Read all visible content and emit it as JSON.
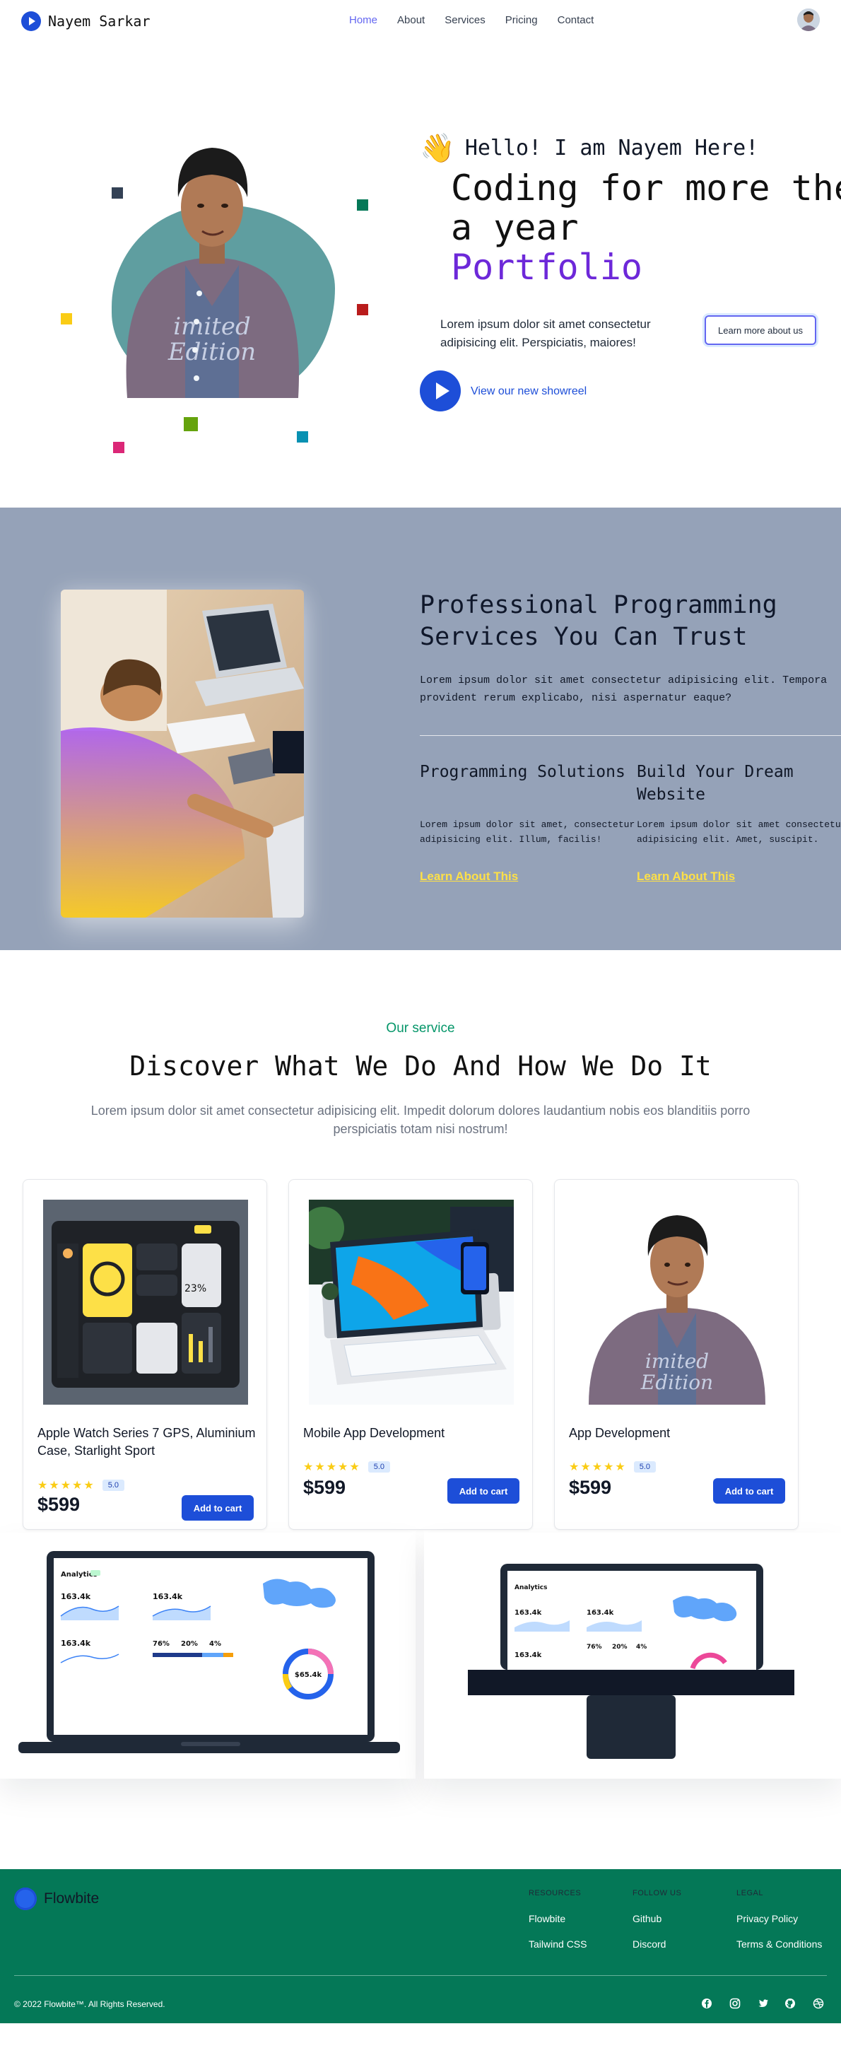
{
  "nav": {
    "brand": "Nayem Sarkar",
    "links": [
      {
        "label": "Home"
      },
      {
        "label": "About"
      },
      {
        "label": "Services"
      },
      {
        "label": "Pricing"
      },
      {
        "label": "Contact"
      }
    ],
    "active_color": "#6366f1"
  },
  "hero": {
    "wave_emoji": "👋",
    "hello": "Hello! I am Nayem Here!",
    "headline_line1": "Coding for more then",
    "headline_line2": "a year",
    "headline_accent": "Portfolio",
    "intro": "Lorem ipsum dolor sit amet consectetur adipisicing elit. Perspiciatis, maiores!",
    "more_button": "Learn more about us",
    "showreel_link": "View our new showreel",
    "accent_color": "#1d4ed8"
  },
  "professional": {
    "title": "Professional Programming Services You Can Trust",
    "lead_line1": "Lorem ipsum dolor sit amet consectetur adipisicing elit. Tempora",
    "lead_line2": "provident rerum explicabo, nisi aspernatur eaque?",
    "features": [
      {
        "title": "Programming Solutions",
        "text_line1": "Lorem ipsum dolor sit amet, consectetur",
        "text_line2": "adipisicing elit. Illum, facilis!",
        "link": "Learn About This"
      },
      {
        "title": "Build Your Dream Website",
        "text_line1": "Lorem ipsum dolor sit amet consectetur",
        "text_line2": "adipisicing elit. Amet, suscipit.",
        "link": "Learn About This"
      }
    ],
    "background": "#95a2b8",
    "link_color": "#fde047"
  },
  "services": {
    "eyebrow": "Our service",
    "title": "Discover What We Do And How We Do It",
    "description": "Lorem ipsum dolor sit amet consectetur adipisicing elit. Impedit dolorum dolores laudantium nobis eos blanditiis porro perspiciatis totam nisi nostrum!",
    "cards": [
      {
        "title": "Apple Watch Series 7 GPS, Aluminium Case, Starlight Sport",
        "rating": "5.0",
        "stars": 5,
        "price": "$599",
        "button": "Add to cart"
      },
      {
        "title": "Mobile App Development",
        "rating": "5.0",
        "stars": 5,
        "price": "$599",
        "button": "Add to cart"
      },
      {
        "title": "App Development",
        "rating": "5.0",
        "stars": 5,
        "price": "$599",
        "button": "Add to cart"
      }
    ]
  },
  "dashboard": {
    "section_label": "Analytics",
    "stats": [
      "163.4k",
      "163.4k",
      "163.4k",
      "163.4k"
    ],
    "percents": [
      "76%",
      "20%",
      "4%"
    ],
    "donut_value": "$65.4k"
  },
  "footer": {
    "brand": "Flowbite",
    "columns": [
      {
        "heading": "RESOURCES",
        "links": [
          "Flowbite",
          "Tailwind CSS"
        ]
      },
      {
        "heading": "FOLLOW US",
        "links": [
          "Github",
          "Discord"
        ]
      },
      {
        "heading": "LEGAL",
        "links": [
          "Privacy Policy",
          "Terms & Conditions"
        ]
      }
    ],
    "copyright": "© 2022 Flowbite™. All Rights Reserved.",
    "social_icons": [
      "facebook-icon",
      "instagram-icon",
      "twitter-icon",
      "github-icon",
      "dribbble-icon"
    ],
    "background": "#047857"
  }
}
